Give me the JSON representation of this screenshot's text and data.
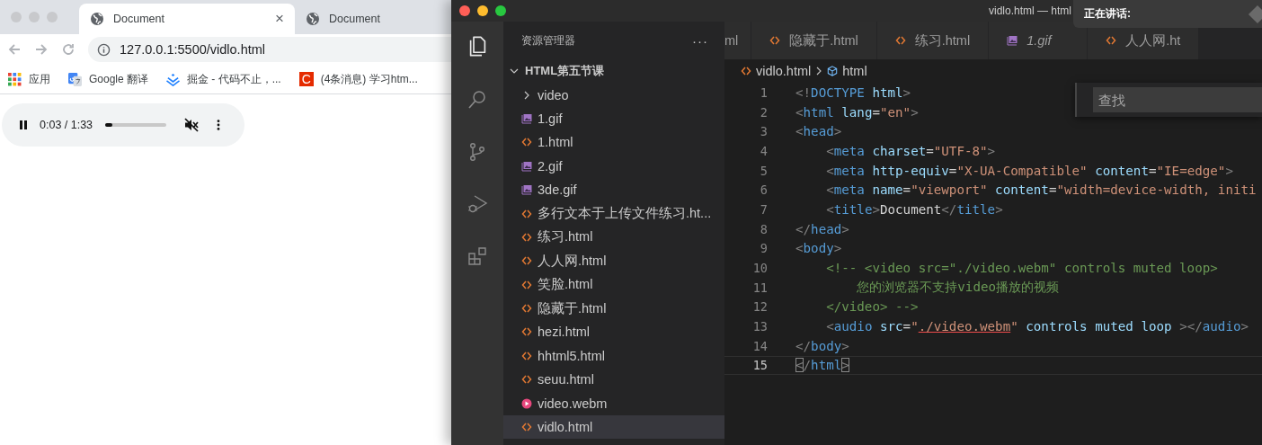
{
  "browser": {
    "tabs": [
      {
        "title": "Document",
        "selected": true,
        "close": "×"
      },
      {
        "title": "Document",
        "selected": false
      }
    ],
    "address": "127.0.0.1:5500/vidlo.html",
    "bookmarks": [
      {
        "kind": "apps",
        "label": "应用"
      },
      {
        "kind": "translate",
        "label": "Google 翻译"
      },
      {
        "kind": "juejin",
        "label": "掘金 - 代码不止，..."
      },
      {
        "kind": "letter",
        "badge": "C",
        "label": "(4条消息) 学习htm..."
      }
    ],
    "audio_player": {
      "time": "0:03 / 1:33",
      "level": 0.12,
      "muted": true
    }
  },
  "editor": {
    "title": "vidlo.html — html",
    "notice": "正在讲话:",
    "explorer": {
      "title": "资源管理器",
      "more": "···",
      "tree": [
        {
          "label": "HTML第五节课",
          "kind": "root",
          "expanded": true,
          "selected": false,
          "children": [
            {
              "label": "video",
              "kind": "folder",
              "expanded": false,
              "selected": false
            },
            {
              "label": "1.gif",
              "kind": "gif",
              "selected": false
            },
            {
              "label": "1.html",
              "kind": "html",
              "selected": false
            },
            {
              "label": "2.gif",
              "kind": "gif",
              "selected": false
            },
            {
              "label": "3de.gif",
              "kind": "gif",
              "selected": false
            },
            {
              "label": "多行文本于上传文件练习.ht...",
              "kind": "html",
              "selected": false
            },
            {
              "label": "练习.html",
              "kind": "html",
              "selected": false
            },
            {
              "label": "人人网.html",
              "kind": "html",
              "selected": false
            },
            {
              "label": "笑脸.html",
              "kind": "html",
              "selected": false
            },
            {
              "label": "隐藏于.html",
              "kind": "html",
              "selected": false
            },
            {
              "label": "hezi.html",
              "kind": "html",
              "selected": false
            },
            {
              "label": "hhtml5.html",
              "kind": "html",
              "selected": false
            },
            {
              "label": "seuu.html",
              "kind": "html",
              "selected": false
            },
            {
              "label": "video.webm",
              "kind": "video",
              "selected": false
            },
            {
              "label": "vidlo.html",
              "kind": "html",
              "selected": true
            }
          ]
        }
      ]
    },
    "tabs": [
      {
        "label": "ml",
        "kind": "none",
        "selected": false,
        "preview": false
      },
      {
        "label": "隐藏于.html",
        "kind": "html",
        "selected": false,
        "preview": false
      },
      {
        "label": "练习.html",
        "kind": "html",
        "selected": false,
        "preview": false
      },
      {
        "label": "1.gif",
        "kind": "gif",
        "selected": false,
        "preview": true
      },
      {
        "label": "人人网.ht",
        "kind": "html",
        "selected": false,
        "preview": false
      }
    ],
    "breadcrumb": {
      "file": "vidlo.html",
      "symbol": "html"
    },
    "find": {
      "placeholder": "查找"
    },
    "lines": [
      {
        "number": "1",
        "current": false,
        "tokens": [
          {
            "text": "<!",
            "kind": "punct"
          },
          {
            "text": "DOCTYPE",
            "kind": "tag"
          },
          {
            "text": " html",
            "kind": "attr"
          },
          {
            "text": ">",
            "kind": "punct"
          }
        ]
      },
      {
        "number": "2",
        "current": false,
        "tokens": [
          {
            "text": "<",
            "kind": "punct"
          },
          {
            "text": "html",
            "kind": "tag"
          },
          {
            "text": " lang",
            "kind": "attr"
          },
          {
            "text": "=",
            "kind": "text"
          },
          {
            "text": "\"en\"",
            "kind": "string"
          },
          {
            "text": ">",
            "kind": "punct"
          }
        ]
      },
      {
        "number": "3",
        "current": false,
        "tokens": [
          {
            "text": "<",
            "kind": "punct"
          },
          {
            "text": "head",
            "kind": "tag"
          },
          {
            "text": ">",
            "kind": "punct"
          }
        ]
      },
      {
        "number": "4",
        "current": false,
        "tokens": [
          {
            "text": "    <",
            "kind": "punct"
          },
          {
            "text": "meta",
            "kind": "tag"
          },
          {
            "text": " charset",
            "kind": "attr"
          },
          {
            "text": "=",
            "kind": "text"
          },
          {
            "text": "\"UTF-8\"",
            "kind": "string"
          },
          {
            "text": ">",
            "kind": "punct"
          }
        ]
      },
      {
        "number": "5",
        "current": false,
        "tokens": [
          {
            "text": "    <",
            "kind": "punct"
          },
          {
            "text": "meta",
            "kind": "tag"
          },
          {
            "text": " http-equiv",
            "kind": "attr"
          },
          {
            "text": "=",
            "kind": "text"
          },
          {
            "text": "\"X-UA-Compatible\"",
            "kind": "string"
          },
          {
            "text": " content",
            "kind": "attr"
          },
          {
            "text": "=",
            "kind": "text"
          },
          {
            "text": "\"IE=edge\"",
            "kind": "string"
          },
          {
            "text": ">",
            "kind": "punct"
          }
        ]
      },
      {
        "number": "6",
        "current": false,
        "tokens": [
          {
            "text": "    <",
            "kind": "punct"
          },
          {
            "text": "meta",
            "kind": "tag"
          },
          {
            "text": " name",
            "kind": "attr"
          },
          {
            "text": "=",
            "kind": "text"
          },
          {
            "text": "\"viewport\"",
            "kind": "string"
          },
          {
            "text": " content",
            "kind": "attr"
          },
          {
            "text": "=",
            "kind": "text"
          },
          {
            "text": "\"width=device-width, initi",
            "kind": "string"
          }
        ]
      },
      {
        "number": "7",
        "current": false,
        "tokens": [
          {
            "text": "    <",
            "kind": "punct"
          },
          {
            "text": "title",
            "kind": "tag"
          },
          {
            "text": ">",
            "kind": "punct"
          },
          {
            "text": "Document",
            "kind": "text"
          },
          {
            "text": "</",
            "kind": "punct"
          },
          {
            "text": "title",
            "kind": "tag"
          },
          {
            "text": ">",
            "kind": "punct"
          }
        ]
      },
      {
        "number": "8",
        "current": false,
        "tokens": [
          {
            "text": "</",
            "kind": "punct"
          },
          {
            "text": "head",
            "kind": "tag"
          },
          {
            "text": ">",
            "kind": "punct"
          }
        ]
      },
      {
        "number": "9",
        "current": false,
        "tokens": [
          {
            "text": "<",
            "kind": "punct"
          },
          {
            "text": "body",
            "kind": "tag"
          },
          {
            "text": ">",
            "kind": "punct"
          }
        ]
      },
      {
        "number": "10",
        "current": false,
        "tokens": [
          {
            "text": "    <!-- <video src=\"./video.webm\" controls muted loop>",
            "kind": "comment"
          }
        ]
      },
      {
        "number": "11",
        "current": false,
        "tokens": [
          {
            "text": "        您的浏览器不支持video播放的视频",
            "kind": "comment"
          }
        ]
      },
      {
        "number": "12",
        "current": false,
        "tokens": [
          {
            "text": "    </video> -->",
            "kind": "comment"
          }
        ]
      },
      {
        "number": "13",
        "current": false,
        "tokens": [
          {
            "text": "    <",
            "kind": "punct"
          },
          {
            "text": "audio",
            "kind": "tag"
          },
          {
            "text": " src",
            "kind": "attr"
          },
          {
            "text": "=",
            "kind": "text"
          },
          {
            "text": "\"",
            "kind": "string"
          },
          {
            "text": "./video.webm",
            "kind": "link"
          },
          {
            "text": "\"",
            "kind": "string"
          },
          {
            "text": " controls muted loop",
            "kind": "attr"
          },
          {
            "text": " ></",
            "kind": "punct"
          },
          {
            "text": "audio",
            "kind": "tag"
          },
          {
            "text": ">",
            "kind": "punct"
          }
        ]
      },
      {
        "number": "14",
        "current": false,
        "tokens": [
          {
            "text": "</",
            "kind": "punct"
          },
          {
            "text": "body",
            "kind": "tag"
          },
          {
            "text": ">",
            "kind": "punct"
          }
        ]
      },
      {
        "number": "15",
        "current": true,
        "tokens": [
          {
            "text": "<",
            "kind": "bracket"
          },
          {
            "text": "/",
            "kind": "punct"
          },
          {
            "text": "html",
            "kind": "tag"
          },
          {
            "text": ">",
            "kind": "bracket"
          }
        ]
      }
    ]
  }
}
